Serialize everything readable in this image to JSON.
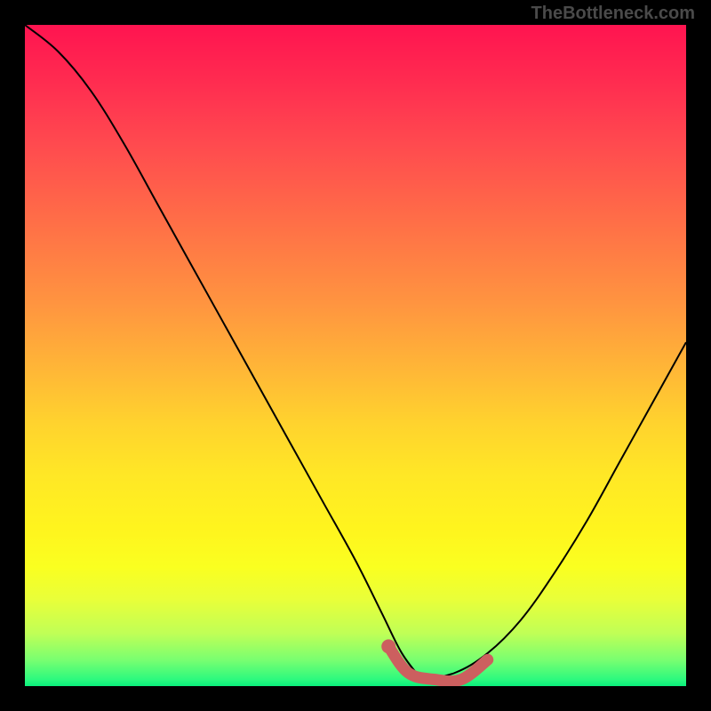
{
  "branding": {
    "text": "TheBottleneck.com"
  },
  "chart_data": {
    "type": "line",
    "title": "",
    "xlabel": "",
    "ylabel": "",
    "xlim": [
      0,
      100
    ],
    "ylim": [
      0,
      100
    ],
    "grid": false,
    "series": [
      {
        "name": "left-curve",
        "x": [
          0,
          5,
          10,
          15,
          20,
          25,
          30,
          35,
          40,
          45,
          50,
          54,
          57,
          60
        ],
        "values": [
          100,
          96,
          90,
          82,
          73,
          64,
          55,
          46,
          37,
          28,
          19,
          11,
          5,
          1
        ]
      },
      {
        "name": "right-curve",
        "x": [
          60,
          65,
          70,
          75,
          80,
          85,
          90,
          95,
          100
        ],
        "values": [
          1,
          2,
          5,
          10,
          17,
          25,
          34,
          43,
          52
        ]
      }
    ],
    "highlight": {
      "name": "optimum-region",
      "x": [
        55,
        58,
        62,
        66,
        70
      ],
      "values": [
        6,
        2,
        1,
        1,
        4
      ]
    },
    "background_gradient": {
      "stops": [
        {
          "pos": 0.0,
          "color": "#ff1450"
        },
        {
          "pos": 0.5,
          "color": "#ffd22e"
        },
        {
          "pos": 0.85,
          "color": "#faff20"
        },
        {
          "pos": 1.0,
          "color": "#0af07c"
        }
      ]
    }
  }
}
